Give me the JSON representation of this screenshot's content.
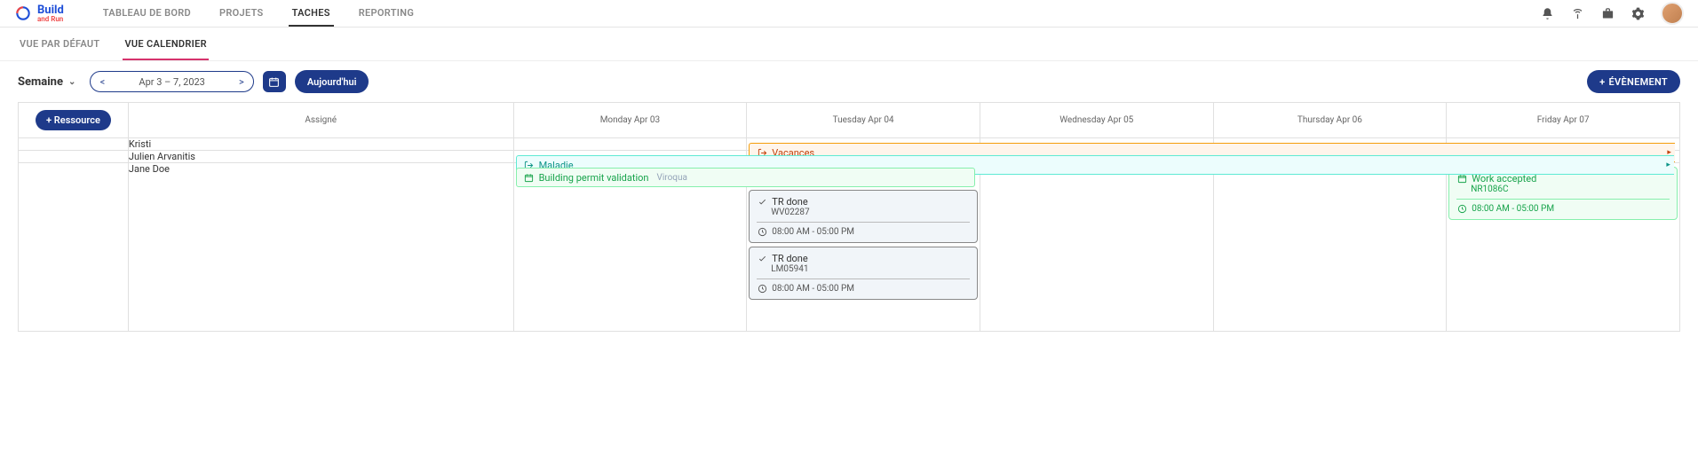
{
  "brand": {
    "name": "Build",
    "sub": "and Run"
  },
  "nav": {
    "items": [
      "TABLEAU DE BORD",
      "PROJETS",
      "TACHES",
      "REPORTING"
    ],
    "active": 2
  },
  "subnav": {
    "items": [
      "VUE PAR DÉFAUT",
      "VUE CALENDRIER"
    ],
    "active": 1
  },
  "toolbar": {
    "view": "Semaine",
    "range": "Apr 3 – 7, 2023",
    "today": "Aujourd'hui",
    "evt_btn": "ÉVÈNEMENT",
    "add_res": "+ Ressource"
  },
  "headers": {
    "assignee": "Assigné",
    "days": [
      "Monday Apr 03",
      "Tuesday Apr 04",
      "Wednesday Apr 05",
      "Thursday Apr 06",
      "Friday Apr 07"
    ]
  },
  "rows": [
    {
      "name": "Kristi"
    },
    {
      "name": "Julien Arvanitis"
    },
    {
      "name": "Jane Doe"
    }
  ],
  "events": {
    "vac": {
      "label": "Vacances"
    },
    "mal": {
      "label": "Maladie"
    },
    "bp": {
      "label": "Building permit validation",
      "loc": "Viroqua"
    },
    "tr1": {
      "title": "TR done",
      "sub": "WV02287",
      "time": "08:00 AM - 05:00 PM"
    },
    "tr2": {
      "title": "TR done",
      "sub": "LM05941",
      "time": "08:00 AM - 05:00 PM"
    },
    "wa": {
      "title": "Work accepted",
      "sub": "NR1086C",
      "time": "08:00 AM - 05:00 PM"
    }
  }
}
